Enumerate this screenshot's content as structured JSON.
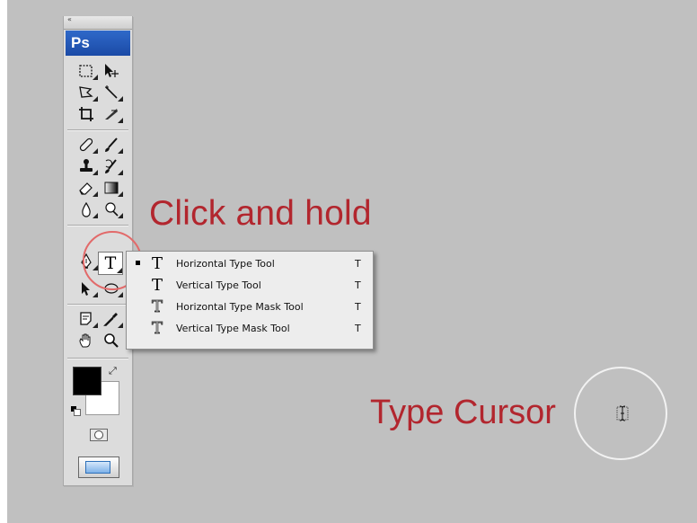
{
  "app": {
    "logo_text": "Ps",
    "grip": "«"
  },
  "toolbox": {
    "tools": [
      {
        "name": "marquee-tool-icon"
      },
      {
        "name": "move-tool-icon"
      },
      {
        "name": "lasso-tool-icon"
      },
      {
        "name": "magic-wand-tool-icon"
      },
      {
        "name": "crop-tool-icon"
      },
      {
        "name": "slice-tool-icon"
      },
      {
        "name": "healing-brush-tool-icon"
      },
      {
        "name": "brush-tool-icon"
      },
      {
        "name": "clone-stamp-tool-icon"
      },
      {
        "name": "history-brush-tool-icon"
      },
      {
        "name": "eraser-tool-icon"
      },
      {
        "name": "gradient-tool-icon"
      },
      {
        "name": "blur-tool-icon"
      },
      {
        "name": "dodge-tool-icon"
      },
      {
        "name": "pen-tool-icon"
      },
      {
        "name": "type-tool-icon"
      },
      {
        "name": "path-selection-tool-icon"
      },
      {
        "name": "shape-tool-icon"
      },
      {
        "name": "notes-tool-icon"
      },
      {
        "name": "eyedropper-tool-icon"
      },
      {
        "name": "hand-tool-icon"
      },
      {
        "name": "zoom-tool-icon"
      }
    ],
    "type_tool_glyph": "T",
    "foreground_color": "#000000",
    "background_color": "#ffffff"
  },
  "flyout": {
    "items": [
      {
        "label": "Horizontal Type Tool",
        "shortcut": "T",
        "icon": "T",
        "selected": true
      },
      {
        "label": "Vertical Type Tool",
        "shortcut": "T",
        "icon": "T",
        "selected": false
      },
      {
        "label": "Horizontal Type Mask Tool",
        "shortcut": "T",
        "icon": "T",
        "selected": false
      },
      {
        "label": "Vertical Type Mask Tool",
        "shortcut": "T",
        "icon": "T",
        "selected": false
      }
    ]
  },
  "annotations": {
    "click_and_hold": "Click and hold",
    "type_cursor": "Type Cursor",
    "accent_color": "#b2262e"
  }
}
